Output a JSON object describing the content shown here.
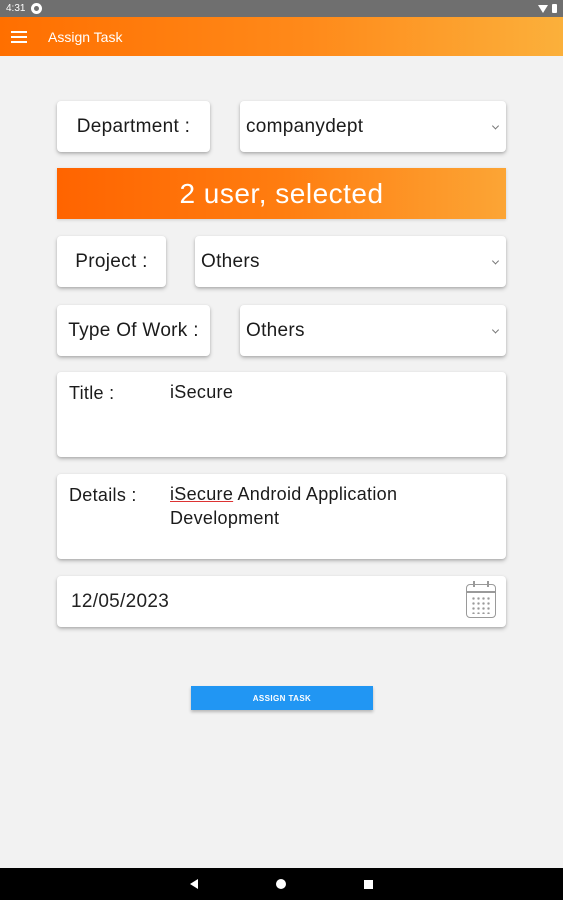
{
  "status_bar": {
    "time": "4:31",
    "icons": [
      "app-notification-icon",
      "wifi-icon",
      "battery-icon"
    ]
  },
  "app_bar": {
    "title": "Assign Task",
    "menu_icon": "hamburger-menu-icon"
  },
  "form": {
    "department": {
      "label": "Department :",
      "value": "companydept"
    },
    "selection_banner": "2 user, selected",
    "project": {
      "label": "Project :",
      "value": "Others"
    },
    "type_of_work": {
      "label": "Type Of Work :",
      "value": "Others"
    },
    "title": {
      "label": "Title :",
      "value": "iSecure"
    },
    "details": {
      "label": "Details :",
      "value_first_word": "iSecure",
      "value_rest": " Android Application Development"
    },
    "date": {
      "value": "12/05/2023",
      "icon": "calendar-icon"
    },
    "submit_label": "ASSIGN TASK"
  },
  "colors": {
    "accent_orange": "#ff6f00",
    "accent_light": "#fbb03b",
    "button_blue": "#2196f3"
  },
  "nav_bar": {
    "icons": [
      "back-icon",
      "home-icon",
      "recents-icon"
    ]
  }
}
